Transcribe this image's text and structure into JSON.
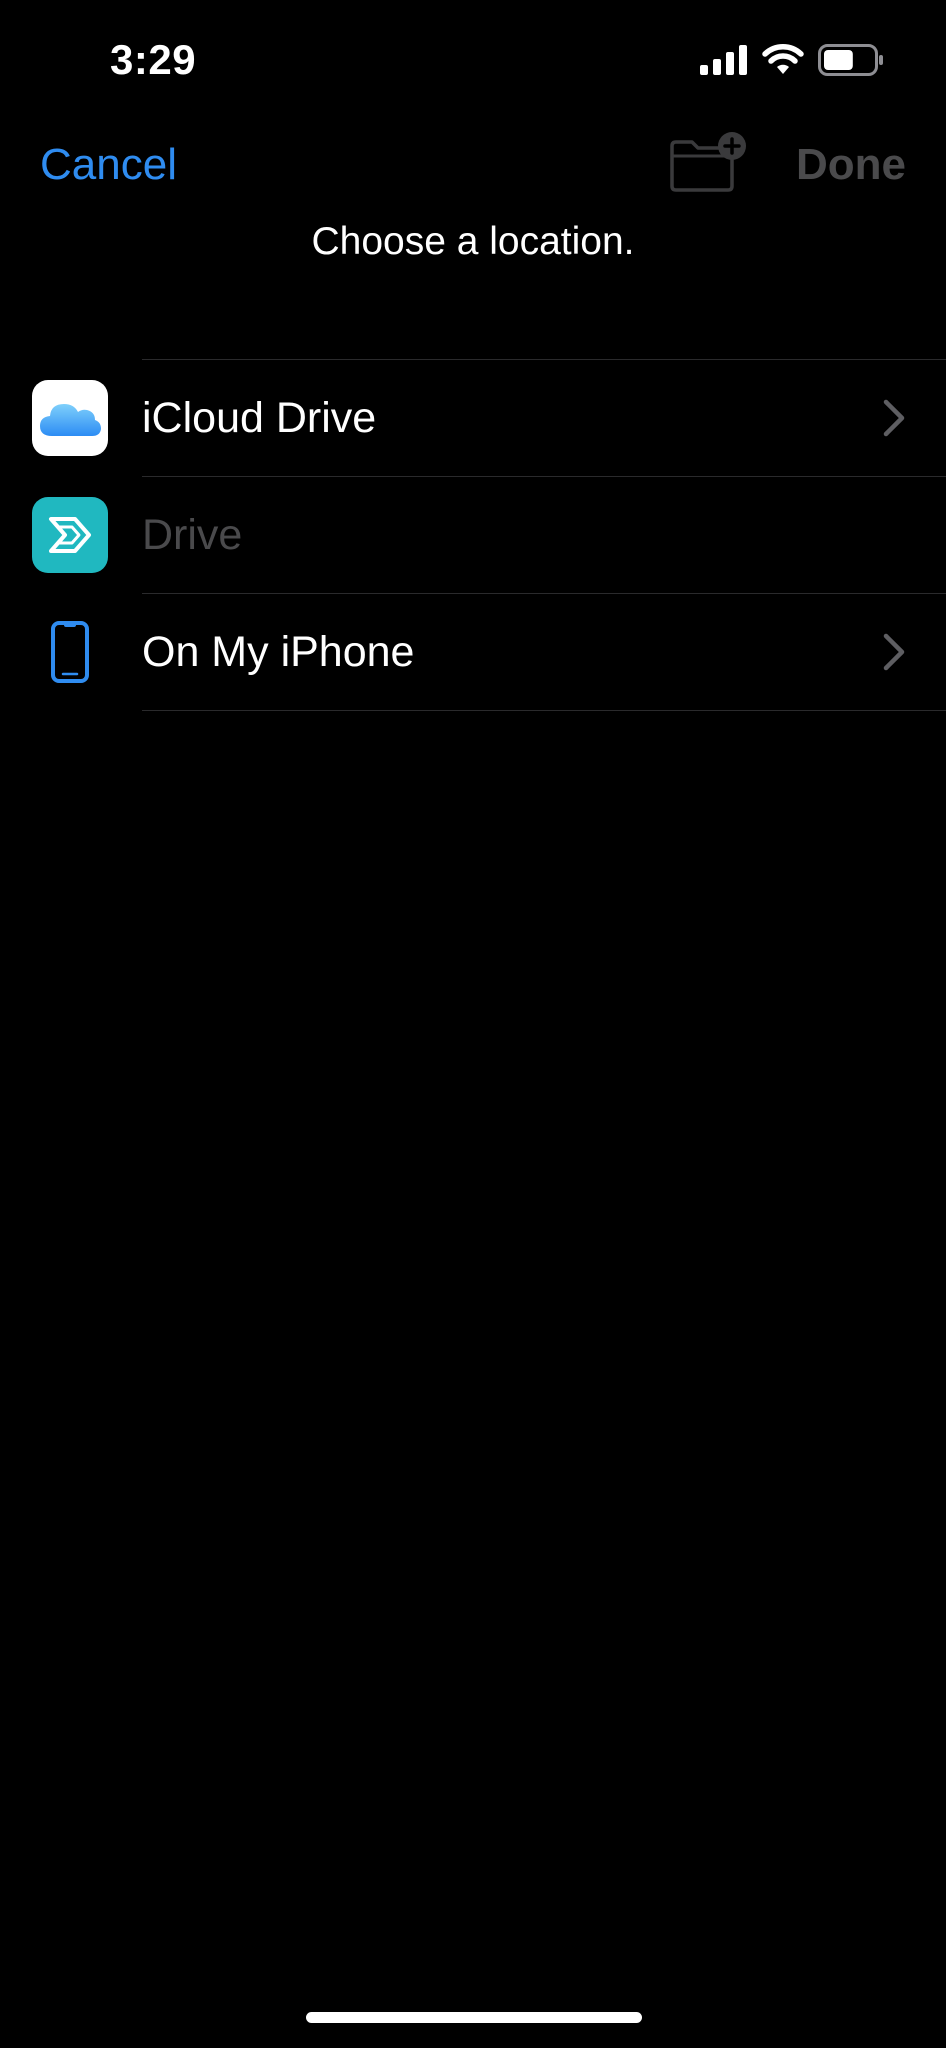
{
  "status_bar": {
    "time": "3:29",
    "signal_icon": "cellular-signal-icon",
    "wifi_icon": "wifi-icon",
    "battery_icon": "battery-icon",
    "battery_level": 0.6
  },
  "nav": {
    "cancel_label": "Cancel",
    "new_folder_icon": "folder-plus-icon",
    "done_label": "Done"
  },
  "prompt": "Choose a location.",
  "locations": [
    {
      "label": "iCloud Drive",
      "icon": "icloud-icon",
      "enabled": true,
      "has_chevron": true
    },
    {
      "label": "Drive",
      "icon": "sync-drive-icon",
      "enabled": false,
      "has_chevron": false
    },
    {
      "label": "On My iPhone",
      "icon": "iphone-icon",
      "enabled": true,
      "has_chevron": true
    }
  ],
  "colors": {
    "background": "#000000",
    "accent": "#2F8CF0",
    "disabled_text": "#4A4A4C",
    "primary_text": "#FFFFFF",
    "separator": "#2A2A2C",
    "chevron": "#5E5E62",
    "drive_icon_bg": "#20B8C0",
    "iphone_icon": "#2F8CF0"
  }
}
